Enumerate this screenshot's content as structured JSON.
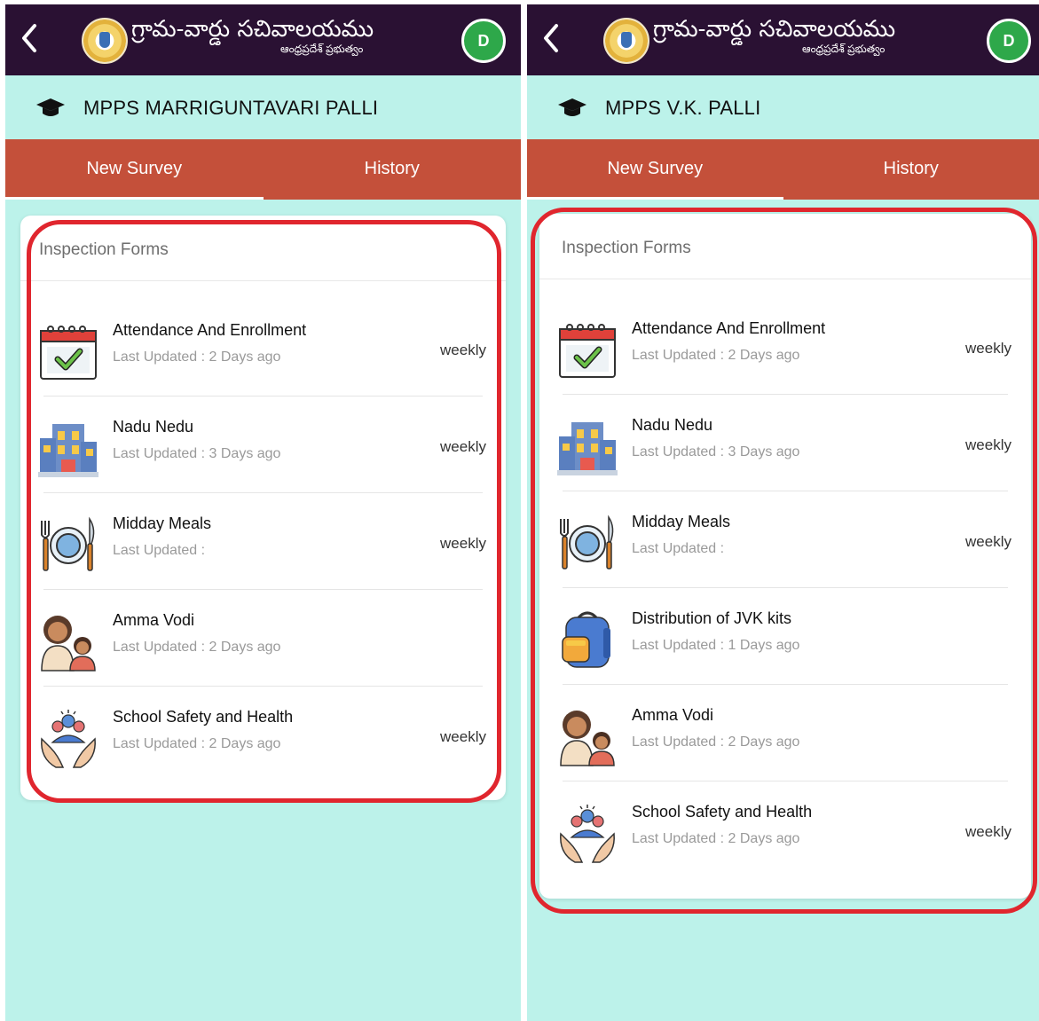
{
  "left": {
    "header": {
      "title": "గ్రామ-వార్డు సచివాలయము",
      "subtitle": "ఆంధ్రప్రదేశ్ ప్రభుత్వం",
      "avatar_initial": "D"
    },
    "school_name": "MPPS MARRIGUNTAVARI PALLI",
    "tabs": [
      "New Survey",
      "History"
    ],
    "card_title": "Inspection Forms",
    "forms": [
      {
        "icon": "calendar-check-icon",
        "name": "Attendance And Enrollment",
        "updated": "Last Updated : 2 Days ago",
        "frequency": "weekly"
      },
      {
        "icon": "school-building-icon",
        "name": "Nadu Nedu",
        "updated": "Last Updated : 3 Days ago",
        "frequency": "weekly"
      },
      {
        "icon": "meal-plate-icon",
        "name": "Midday Meals",
        "updated": "Last Updated :",
        "frequency": "weekly"
      },
      {
        "icon": "mother-child-icon",
        "name": "Amma Vodi",
        "updated": "Last Updated : 2 Days ago",
        "frequency": ""
      },
      {
        "icon": "safety-hands-icon",
        "name": "School Safety and Health",
        "updated": "Last Updated : 2 Days ago",
        "frequency": "weekly"
      }
    ]
  },
  "right": {
    "header": {
      "title": "గ్రామ-వార్డు సచివాలయము",
      "subtitle": "ఆంధ్రప్రదేశ్ ప్రభుత్వం",
      "avatar_initial": "D"
    },
    "school_name": "MPPS V.K. PALLI",
    "tabs": [
      "New Survey",
      "History"
    ],
    "card_title": "Inspection Forms",
    "forms": [
      {
        "icon": "calendar-check-icon",
        "name": "Attendance And Enrollment",
        "updated": "Last Updated : 2 Days ago",
        "frequency": "weekly"
      },
      {
        "icon": "school-building-icon",
        "name": "Nadu Nedu",
        "updated": "Last Updated : 3 Days ago",
        "frequency": "weekly"
      },
      {
        "icon": "meal-plate-icon",
        "name": "Midday Meals",
        "updated": "Last Updated :",
        "frequency": "weekly"
      },
      {
        "icon": "backpack-icon",
        "name": "Distribution of JVK kits",
        "updated": "Last Updated : 1 Days ago",
        "frequency": ""
      },
      {
        "icon": "mother-child-icon",
        "name": "Amma Vodi",
        "updated": "Last Updated : 2 Days ago",
        "frequency": ""
      },
      {
        "icon": "safety-hands-icon",
        "name": "School Safety and Health",
        "updated": "Last Updated : 2 Days ago",
        "frequency": "weekly"
      }
    ]
  },
  "colors": {
    "appbar": "#2a1133",
    "background": "#bcf2ea",
    "tabs": "#c4503a",
    "avatar": "#2ea84a",
    "highlight": "#e0262e"
  }
}
